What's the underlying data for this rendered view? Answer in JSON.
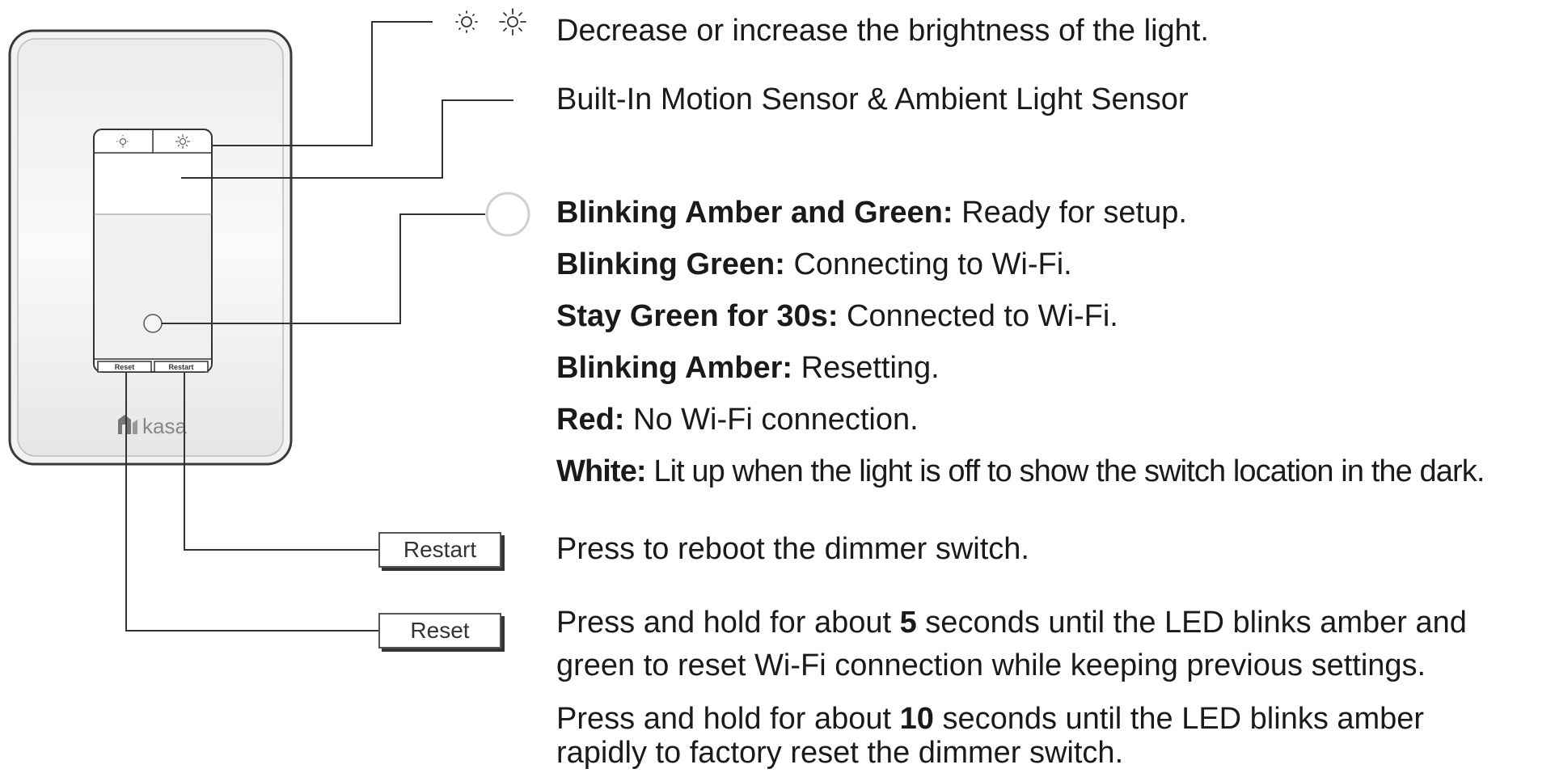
{
  "device": {
    "brand": "kasa",
    "reset_label": "Reset",
    "restart_label": "Restart"
  },
  "callouts": {
    "brightness": "Decrease or increase the brightness of the light.",
    "sensor": "Built-In Motion Sensor & Ambient Light Sensor",
    "led_states": [
      {
        "title": "Blinking Amber and Green:",
        "text": " Ready for setup."
      },
      {
        "title": "Blinking Green:",
        "text": " Connecting to Wi-Fi."
      },
      {
        "title": "Stay Green for 30s:",
        "text": " Connected to Wi-Fi."
      },
      {
        "title": "Blinking Amber:",
        "text": " Resetting."
      },
      {
        "title": "Red:",
        "text": " No Wi-Fi connection."
      },
      {
        "title": "White:",
        "text": " Lit up when the light is off to show the switch location in the dark."
      }
    ],
    "restart": "Press to reboot the dimmer switch.",
    "reset_5_prefix": "Press and hold for about ",
    "reset_5_num": "5",
    "reset_5_suffix": " seconds until the LED blinks amber and",
    "reset_5_line2": "green to reset Wi-Fi connection while keeping previous settings.",
    "reset_10_prefix": "Press and hold for about ",
    "reset_10_num": "10",
    "reset_10_suffix": " seconds until the LED blinks amber",
    "reset_10_line2": "rapidly to factory reset the dimmer switch."
  },
  "icons": [
    "sun-dim-icon",
    "sun-bright-icon",
    "led-ring-icon",
    "kasa-logo-icon"
  ]
}
